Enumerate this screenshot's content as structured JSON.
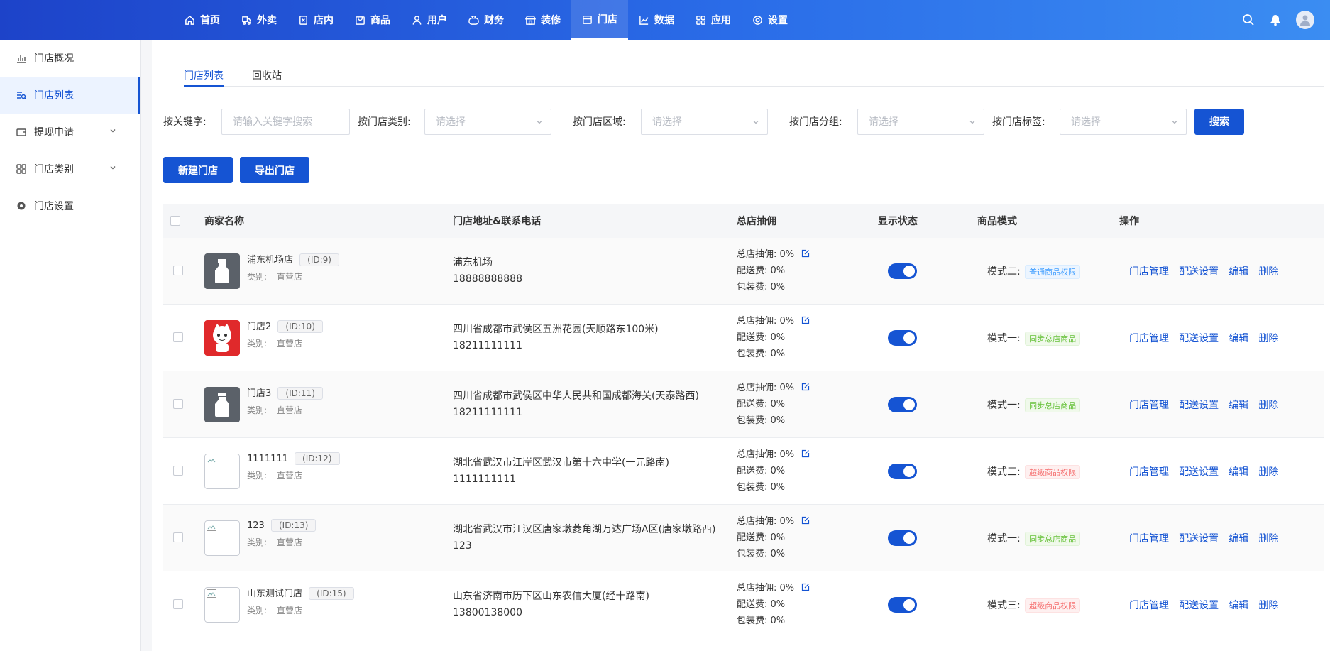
{
  "nav": {
    "items": [
      {
        "label": "首页",
        "icon": "home-icon"
      },
      {
        "label": "外卖",
        "icon": "delivery-icon"
      },
      {
        "label": "店内",
        "icon": "dine-in-icon"
      },
      {
        "label": "商品",
        "icon": "goods-icon"
      },
      {
        "label": "用户",
        "icon": "user-icon"
      },
      {
        "label": "财务",
        "icon": "finance-icon"
      },
      {
        "label": "装修",
        "icon": "decoration-icon"
      },
      {
        "label": "门店",
        "icon": "store-icon"
      },
      {
        "label": "数据",
        "icon": "data-icon"
      },
      {
        "label": "应用",
        "icon": "apps-icon"
      },
      {
        "label": "设置",
        "icon": "settings-icon"
      }
    ],
    "active_index": 7
  },
  "sidebar": {
    "items": [
      {
        "label": "门店概况"
      },
      {
        "label": "门店列表"
      },
      {
        "label": "提现申请"
      },
      {
        "label": "门店类别"
      },
      {
        "label": "门店设置"
      }
    ]
  },
  "tabs": [
    {
      "label": "门店列表"
    },
    {
      "label": "回收站"
    }
  ],
  "filters": {
    "keyword_label": "按关键字:",
    "keyword_placeholder": "请输入关键字搜索",
    "category_label": "按门店类别:",
    "region_label": "按门店区域:",
    "group_label": "按门店分组:",
    "tag_label": "按门店标签:",
    "select_placeholder": "请选择",
    "search_button": "搜索"
  },
  "actions": {
    "new_store": "新建门店",
    "export_store": "导出门店"
  },
  "table": {
    "headers": {
      "name": "商家名称",
      "address": "门店地址&联系电话",
      "commission": "总店抽佣",
      "status": "显示状态",
      "mode": "商品模式",
      "ops": "操作"
    },
    "category_label": "类别:",
    "commission_label": "总店抽佣:",
    "delivery_label": "配送费:",
    "packing_label": "包装费:",
    "op_manage": "门店管理",
    "op_delivery": "配送设置",
    "op_edit": "编辑",
    "op_delete": "删除",
    "rows": [
      {
        "name": "浦东机场店",
        "id": "(ID:9)",
        "category": "直营店",
        "address": "浦东机场",
        "phone": "18888888888",
        "commission": "0%",
        "delivery": "0%",
        "packing": "0%",
        "enabled": true,
        "mode_label": "模式二:",
        "mode_tag": "普通商品权限",
        "tag_color": "blue",
        "thumb": "bottle"
      },
      {
        "name": "门店2",
        "id": "(ID:10)",
        "category": "直营店",
        "address": "四川省成都市武侯区五洲花园(天顺路东100米)",
        "phone": "18211111111",
        "commission": "0%",
        "delivery": "0%",
        "packing": "0%",
        "enabled": true,
        "mode_label": "模式一:",
        "mode_tag": "同步总店商品",
        "tag_color": "green",
        "thumb": "cartoon"
      },
      {
        "name": "门店3",
        "id": "(ID:11)",
        "category": "直营店",
        "address": "四川省成都市武侯区中华人民共和国成都海关(天泰路西)",
        "phone": "18211111111",
        "commission": "0%",
        "delivery": "0%",
        "packing": "0%",
        "enabled": true,
        "mode_label": "模式一:",
        "mode_tag": "同步总店商品",
        "tag_color": "green",
        "thumb": "bottle"
      },
      {
        "name": "1111111",
        "id": "(ID:12)",
        "category": "直营店",
        "address": "湖北省武汉市江岸区武汉市第十六中学(一元路南)",
        "phone": "1111111111",
        "commission": "0%",
        "delivery": "0%",
        "packing": "0%",
        "enabled": true,
        "mode_label": "模式三:",
        "mode_tag": "超级商品权限",
        "tag_color": "red",
        "thumb": "broken"
      },
      {
        "name": "123",
        "id": "(ID:13)",
        "category": "直营店",
        "address": "湖北省武汉市江汉区唐家墩菱角湖万达广场A区(唐家墩路西)",
        "phone": "123",
        "commission": "0%",
        "delivery": "0%",
        "packing": "0%",
        "enabled": true,
        "mode_label": "模式一:",
        "mode_tag": "同步总店商品",
        "tag_color": "green",
        "thumb": "broken"
      },
      {
        "name": "山东测试门店",
        "id": "(ID:15)",
        "category": "直营店",
        "address": "山东省济南市历下区山东农信大厦(经十路南)",
        "phone": "13800138000",
        "commission": "0%",
        "delivery": "0%",
        "packing": "0%",
        "enabled": true,
        "mode_label": "模式三:",
        "mode_tag": "超级商品权限",
        "tag_color": "red",
        "thumb": "broken"
      }
    ]
  }
}
